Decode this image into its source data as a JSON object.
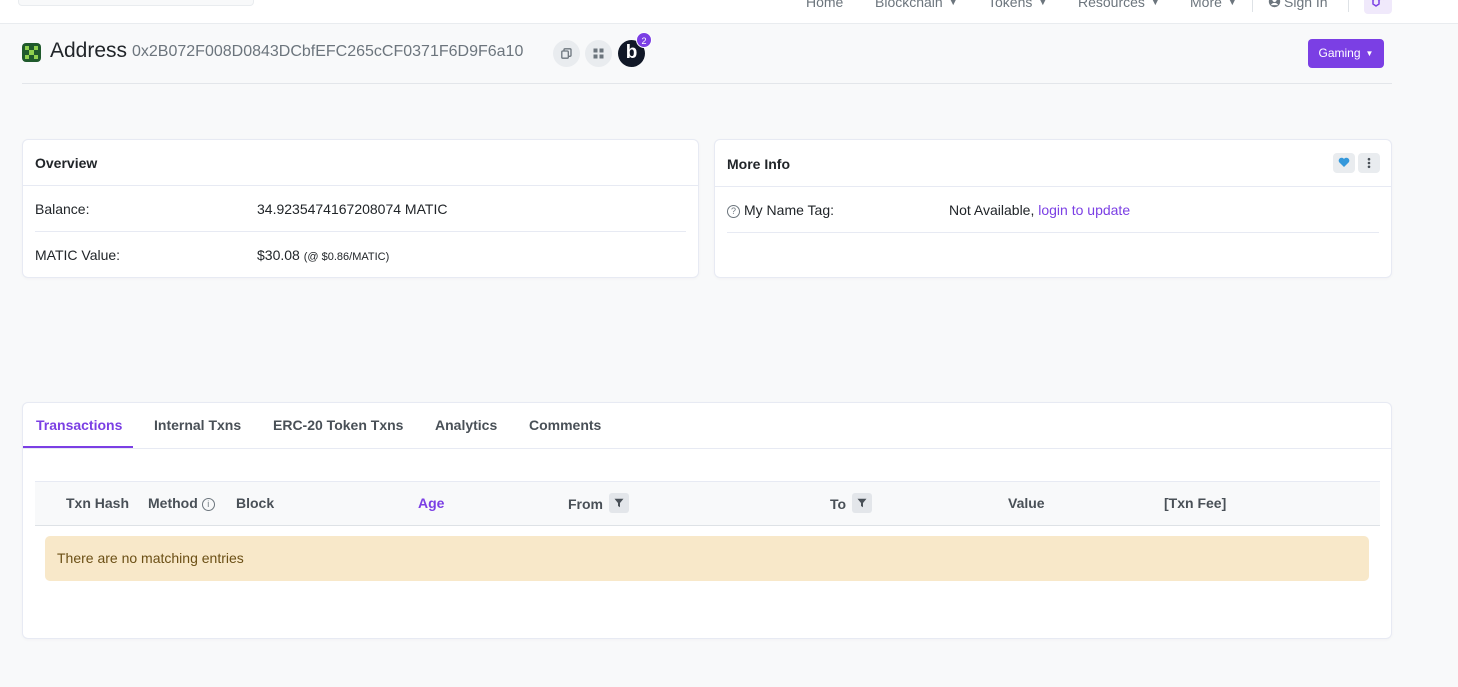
{
  "nav": {
    "items": [
      "Home",
      "Blockchain",
      "Tokens",
      "Resources",
      "More"
    ],
    "sign_in": "Sign In"
  },
  "header": {
    "label": "Address",
    "address": "0x2B072F008D0843DCbfEFC265cCF0371F6D9F6a10",
    "badge_letter": "b",
    "badge_count": "2",
    "gaming_label": "Gaming"
  },
  "overview": {
    "title": "Overview",
    "balance_label": "Balance:",
    "balance_value": "34.9235474167208074 MATIC",
    "value_label": "MATIC Value:",
    "value_amount": "$30.08",
    "value_rate": "(@ $0.86/MATIC)"
  },
  "more_info": {
    "title": "More Info",
    "tag_label": "My Name Tag:",
    "tag_value": "Not Available,",
    "tag_link": "login to update"
  },
  "tabs": [
    "Transactions",
    "Internal Txns",
    "ERC-20 Token Txns",
    "Analytics",
    "Comments"
  ],
  "table": {
    "columns": [
      "Txn Hash",
      "Method",
      "Block",
      "Age",
      "From",
      "To",
      "Value",
      "[Txn Fee]"
    ],
    "empty_message": "There are no matching entries"
  },
  "colors": {
    "accent": "#7b3fe4",
    "alert_bg": "#f8e8c9",
    "alert_text": "#6b4f15"
  }
}
